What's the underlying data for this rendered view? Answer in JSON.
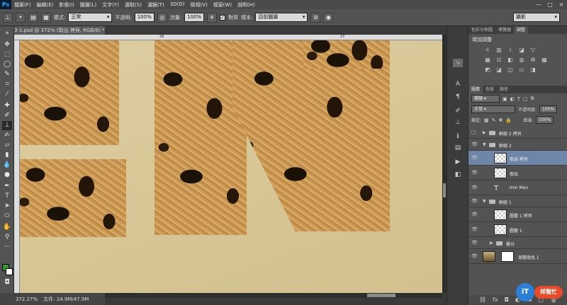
{
  "app": {
    "logo": "Ps"
  },
  "menu": [
    "檔案(F)",
    "編輯(E)",
    "影像(I)",
    "圖層(L)",
    "文字(Y)",
    "選取(S)",
    "濾鏡(T)",
    "3D(D)",
    "檢視(V)",
    "視窗(W)",
    "說明(H)"
  ],
  "window_controls": [
    "—",
    "□",
    "×"
  ],
  "options": {
    "mode_label": "模式:",
    "mode_value": "正常",
    "opacity_label": "不透明:",
    "opacity_value": "100%",
    "flow_label": "流量:",
    "flow_value": "100%",
    "align_label": "對齊",
    "sample_label": "樣本:",
    "sample_value": "目前圖層",
    "workspace": "攝影"
  },
  "document": {
    "tab_title": "3-1.psd @ 372% (取出 拷貝, RGB/8) *",
    "close": "×"
  },
  "ruler": {
    "marks": [
      "26",
      "27"
    ]
  },
  "status": {
    "zoom": "372.27%",
    "info": "文件: 24.9M/47.9M"
  },
  "panels": {
    "top_tabs": [
      "色彩分佈圖",
      "導覽器",
      "調整"
    ],
    "adjust_title": "增加調整",
    "layer_tabs": [
      "圖層",
      "色版",
      "路徑"
    ],
    "filter_kind": "種類",
    "blend_mode": "正常",
    "opacity_label": "不透明度:",
    "opacity_value": "100%",
    "lock_label": "鎖定:",
    "fill_label": "填滿:",
    "fill_value": "100%"
  },
  "layers": [
    {
      "name": "群組 2 拷貝",
      "kind": "group",
      "indent": 0,
      "visible": false,
      "expanded": false
    },
    {
      "name": "群組 2",
      "kind": "group",
      "indent": 0,
      "visible": true,
      "expanded": true
    },
    {
      "name": "取出 拷貝",
      "kind": "pixel",
      "indent": 1,
      "visible": true,
      "selected": true
    },
    {
      "name": "取出",
      "kind": "pixel",
      "indent": 1,
      "visible": true
    },
    {
      "name": "Iron Man",
      "kind": "text",
      "indent": 1,
      "visible": true
    },
    {
      "name": "群組 1",
      "kind": "group",
      "indent": 0,
      "visible": true,
      "expanded": true
    },
    {
      "name": "圖層 1 拷貝",
      "kind": "pixel",
      "indent": 1,
      "visible": true
    },
    {
      "name": "圖層 1",
      "kind": "pixel",
      "indent": 1,
      "visible": true
    },
    {
      "name": "屬分",
      "kind": "group",
      "indent": 1,
      "visible": true,
      "expanded": false
    },
    {
      "name": "漸層填色 1",
      "kind": "fill",
      "indent": 0,
      "visible": true
    }
  ],
  "colors": {
    "foreground": "#2d9a2a",
    "background": "#ffffff"
  },
  "watermark": {
    "mark": "iT",
    "text": "邦幫忙"
  }
}
